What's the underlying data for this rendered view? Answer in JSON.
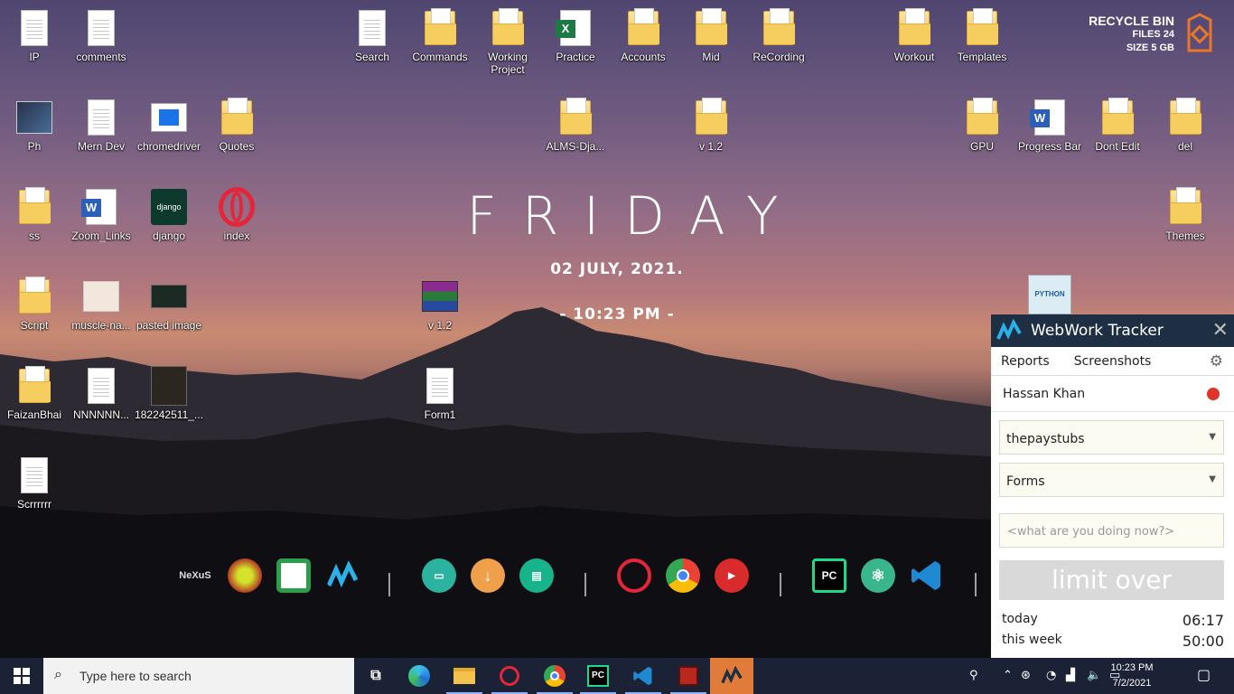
{
  "desktop": {
    "icons": [
      {
        "label": "IP",
        "type": "doc"
      },
      {
        "label": "comments",
        "type": "doc"
      },
      {
        "label": "Search",
        "type": "doc"
      },
      {
        "label": "Commands",
        "type": "folder"
      },
      {
        "label": "Working Project",
        "type": "folder"
      },
      {
        "label": "Practice",
        "type": "excel"
      },
      {
        "label": "Accounts",
        "type": "folder"
      },
      {
        "label": "Mid",
        "type": "folder"
      },
      {
        "label": "ReCording",
        "type": "folder"
      },
      {
        "label": "Workout",
        "type": "folder"
      },
      {
        "label": "Templates",
        "type": "folder"
      },
      {
        "label": "Ph",
        "type": "image"
      },
      {
        "label": "Mern Dev",
        "type": "doc"
      },
      {
        "label": "chromedriver",
        "type": "app"
      },
      {
        "label": "Quotes",
        "type": "folder"
      },
      {
        "label": "ALMS-Dja...",
        "type": "folder"
      },
      {
        "label": "v 1.2",
        "type": "folder"
      },
      {
        "label": "GPU",
        "type": "folder"
      },
      {
        "label": "Progress Bar",
        "type": "word"
      },
      {
        "label": "Dont Edit",
        "type": "folder"
      },
      {
        "label": "del",
        "type": "folder"
      },
      {
        "label": "ss",
        "type": "folder"
      },
      {
        "label": "Zoom_Links",
        "type": "word"
      },
      {
        "label": "django",
        "type": "django"
      },
      {
        "label": "index",
        "type": "opera"
      },
      {
        "label": "Themes",
        "type": "folder"
      },
      {
        "label": "Script",
        "type": "folder"
      },
      {
        "label": "muscle-na...",
        "type": "image"
      },
      {
        "label": "pasted image",
        "type": "image"
      },
      {
        "label": "v 1.2",
        "type": "rar"
      },
      {
        "label": "FaizanBhai",
        "type": "folder"
      },
      {
        "label": "NNNNNN...",
        "type": "doc"
      },
      {
        "label": "182242511_...",
        "type": "image"
      },
      {
        "label": "Form1",
        "type": "doc"
      },
      {
        "label": "Scrrrrrr",
        "type": "doc"
      }
    ],
    "python_file_badge": "PYTHON"
  },
  "widget": {
    "day": "FRIDAY",
    "date": "02  JULY, 2021.",
    "time": "- 10:23 PM -"
  },
  "recycle_bin": {
    "title": "RECYCLE BIN",
    "files": "FILES 24",
    "size": "SIZE 5 GB"
  },
  "dock": {
    "items": [
      "nexus-icon",
      "chameleon-icon",
      "trello-icon",
      "webwork-icon",
      "monitor-icon",
      "download-icon",
      "docs-icon",
      "opera-icon",
      "chrome-icon",
      "youtube-icon",
      "pycharm-icon",
      "atom-icon",
      "vscode-icon"
    ],
    "nexus_text": "NeXuS",
    "pycharm_text": "PC"
  },
  "webwork": {
    "title": "WebWork Tracker",
    "close": "✕",
    "tabs": [
      "Reports",
      "Screenshots"
    ],
    "user": "Hassan Khan",
    "project": "thepaystubs",
    "task": "Forms",
    "note_placeholder": "<what are you doing now?>",
    "limit_label": "limit over",
    "today_label": "today",
    "today_value": "06:17",
    "week_label": "this week",
    "week_value": "50:00",
    "status_color": "#e0352b"
  },
  "taskbar": {
    "search_placeholder": "Type here to search",
    "pinned": [
      "task-view-icon",
      "edge-icon",
      "file-explorer-icon",
      "opera-icon",
      "chrome-icon",
      "pycharm-icon",
      "vscode-icon",
      "dota-icon",
      "webwork-icon"
    ],
    "pycharm_text": "PC",
    "clock_time": "10:23 PM",
    "clock_date": "7/2/2021"
  },
  "colors": {
    "taskbar": "#1c2235",
    "webwork_header": "#1f2f43",
    "webwork_active": "#e07b39",
    "accent": "#8cb4ff"
  }
}
